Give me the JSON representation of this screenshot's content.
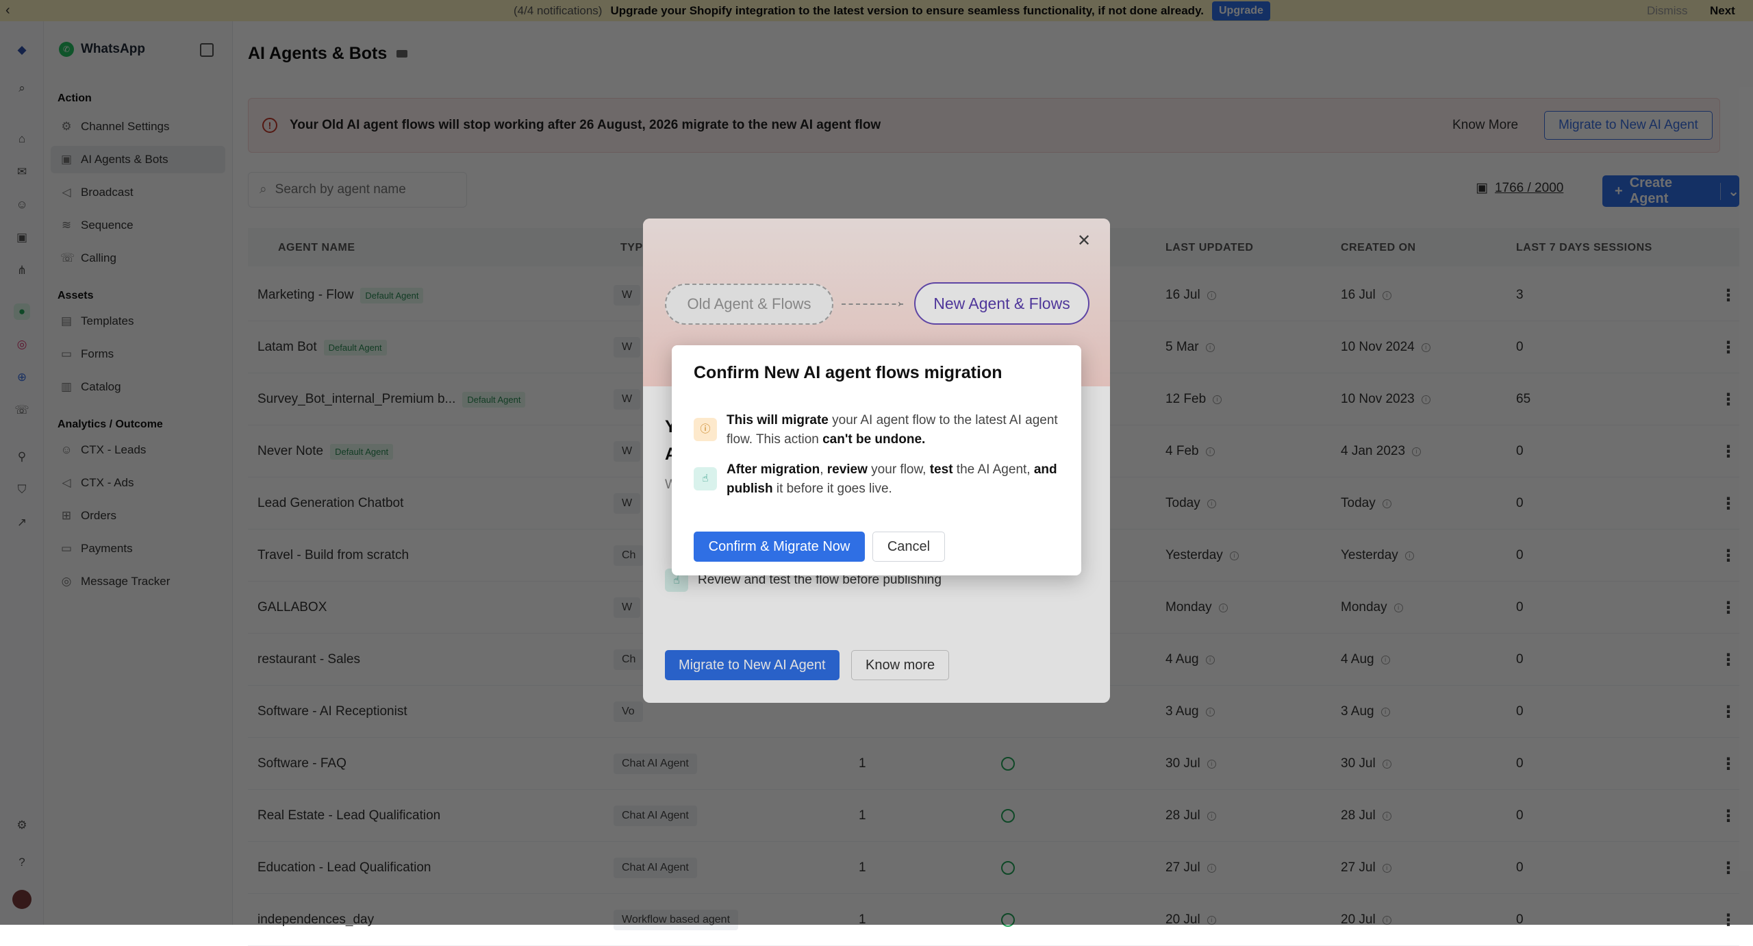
{
  "notification": {
    "back": "‹",
    "count": "(4/4 notifications)",
    "message": "Upgrade your Shopify integration to the latest version to ensure seamless functionality, if not done already.",
    "upgrade": "Upgrade",
    "dismiss": "Dismiss",
    "next": "Next"
  },
  "sidebar": {
    "channel": "WhatsApp",
    "sections": [
      {
        "title": "Action",
        "items": [
          "Channel Settings",
          "AI Agents & Bots",
          "Broadcast",
          "Sequence",
          "Calling"
        ]
      },
      {
        "title": "Assets",
        "items": [
          "Templates",
          "Forms",
          "Catalog"
        ]
      },
      {
        "title": "Analytics / Outcome",
        "items": [
          "CTX - Leads",
          "CTX - Ads",
          "Orders",
          "Payments",
          "Message Tracker"
        ]
      }
    ]
  },
  "page": {
    "title": "AI Agents & Bots",
    "banner_text": "Your Old AI agent flows will stop working after 26 August, 2026 migrate to the new AI agent flow",
    "know_more": "Know More",
    "migrate": "Migrate to New AI Agent",
    "search_placeholder": "Search by agent name",
    "quota": "1766 / 2000",
    "create": "Create Agent",
    "headers": {
      "name": "AGENT NAME",
      "type": "TYP",
      "updated": "LAST UPDATED",
      "created": "CREATED ON",
      "sessions": "LAST 7 DAYS SESSIONS"
    }
  },
  "rows": [
    {
      "name": "Marketing - Flow",
      "badge": "Default Agent",
      "type": "W",
      "ver": "",
      "updated": "16 Jul",
      "created": "16 Jul",
      "sessions": "3"
    },
    {
      "name": "Latam Bot",
      "badge": "Default Agent",
      "type": "W",
      "ver": "",
      "updated": "5 Mar",
      "created": "10 Nov 2024",
      "sessions": "0"
    },
    {
      "name": "Survey_Bot_internal_Premium b...",
      "badge": "Default Agent",
      "type": "W",
      "ver": "",
      "updated": "12 Feb",
      "created": "10 Nov 2023",
      "sessions": "65"
    },
    {
      "name": "Never Note",
      "badge": "Default Agent",
      "type": "W",
      "ver": "",
      "updated": "4 Feb",
      "created": "4 Jan 2023",
      "sessions": "0"
    },
    {
      "name": "Lead Generation Chatbot",
      "badge": "",
      "type": "W",
      "ver": "",
      "updated": "Today",
      "created": "Today",
      "sessions": "0"
    },
    {
      "name": "Travel - Build from scratch",
      "badge": "",
      "type": "Ch",
      "ver": "",
      "updated": "Yesterday",
      "created": "Yesterday",
      "sessions": "0"
    },
    {
      "name": "GALLABOX",
      "badge": "",
      "type": "W",
      "ver": "",
      "updated": "Monday",
      "created": "Monday",
      "sessions": "0"
    },
    {
      "name": "restaurant - Sales",
      "badge": "",
      "type": "Ch",
      "ver": "",
      "updated": "4 Aug",
      "created": "4 Aug",
      "sessions": "0"
    },
    {
      "name": "Software - AI Receptionist",
      "badge": "",
      "type": "Vo",
      "ver": "",
      "updated": "3 Aug",
      "created": "3 Aug",
      "sessions": "0"
    },
    {
      "name": "Software - FAQ",
      "badge": "",
      "type": "Chat AI Agent",
      "ver": "1",
      "updated": "30 Jul",
      "created": "30 Jul",
      "sessions": "0"
    },
    {
      "name": "Real Estate - Lead Qualification",
      "badge": "",
      "type": "Chat AI Agent",
      "ver": "1",
      "updated": "28 Jul",
      "created": "28 Jul",
      "sessions": "0"
    },
    {
      "name": "Education - Lead Qualification",
      "badge": "",
      "type": "Chat AI Agent",
      "ver": "1",
      "updated": "27 Jul",
      "created": "27 Jul",
      "sessions": "0"
    },
    {
      "name": "independences_day",
      "badge": "",
      "type": "Workflow based agent",
      "ver": "1",
      "updated": "20 Jul",
      "created": "20 Jul",
      "sessions": "0"
    }
  ],
  "migration_modal": {
    "old": "Old Agent & Flows",
    "new": "New Agent & Flows",
    "title_partial": "Y A",
    "sub_partial": "W",
    "review_row": "Review and test the flow before publishing",
    "migrate": "Migrate to New AI Agent",
    "know_more": "Know more"
  },
  "confirm_modal": {
    "title": "Confirm New AI agent flows migration",
    "confirm": "Confirm & Migrate Now",
    "cancel": "Cancel"
  }
}
